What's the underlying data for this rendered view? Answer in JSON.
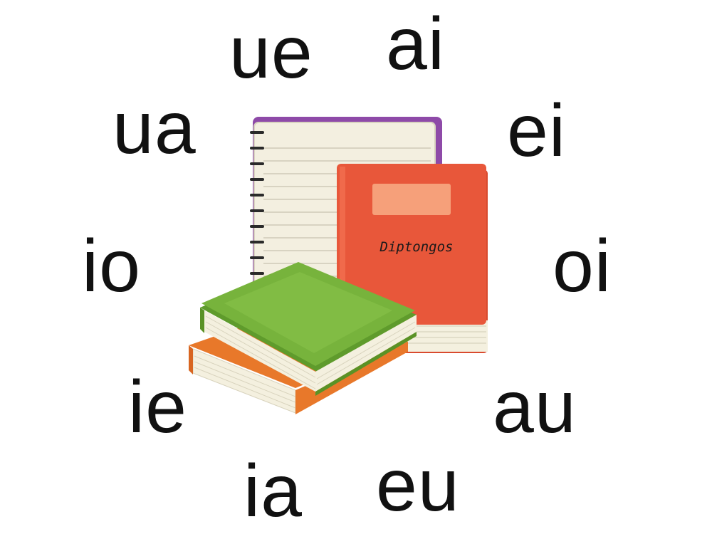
{
  "diphthongs": {
    "ue": "ue",
    "ai": "ai",
    "ua": "ua",
    "ei": "ei",
    "io": "io",
    "oi": "oi",
    "ie": "ie",
    "au": "au",
    "ia": "ia",
    "eu": "eu"
  },
  "book": {
    "title": "Diptongos"
  },
  "colors": {
    "text": "#111111",
    "notebook_purple": "#8e4aa8",
    "red_book": "#e8573a",
    "green_book": "#77b33c",
    "orange_book": "#e8782a",
    "page_cream": "#f4f0df"
  }
}
